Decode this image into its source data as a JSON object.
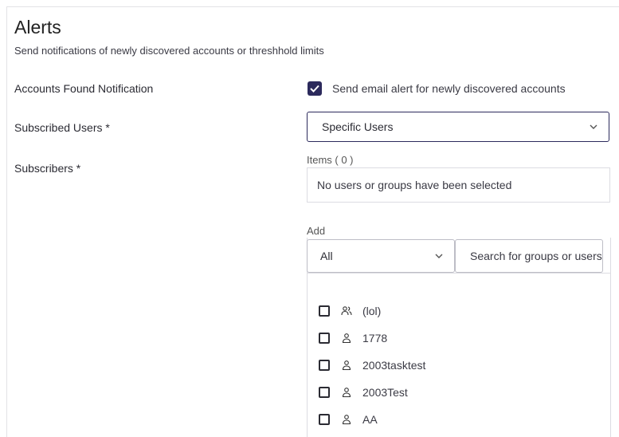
{
  "alerts": {
    "title": "Alerts",
    "subtitle": "Send notifications of newly discovered accounts or threshhold limits"
  },
  "accounts_found": {
    "label": "Accounts Found Notification",
    "checkbox_label": "Send email alert for newly discovered accounts",
    "checked": true
  },
  "subscribed_users": {
    "label": "Subscribed Users *",
    "value": "Specific Users"
  },
  "subscribers": {
    "label": "Subscribers *",
    "items_label": "Items ( 0 )",
    "empty_text": "No users or groups have been selected"
  },
  "add": {
    "label": "Add",
    "filter_value": "All",
    "search_placeholder": "Search for groups or users",
    "list": [
      {
        "name": "(lol)",
        "type": "group",
        "icon": "group-icon"
      },
      {
        "name": "1778",
        "type": "user",
        "icon": "user-icon"
      },
      {
        "name": "2003tasktest",
        "type": "user",
        "icon": "user-icon"
      },
      {
        "name": "2003Test",
        "type": "user",
        "icon": "user-icon"
      },
      {
        "name": "AA",
        "type": "user",
        "icon": "user-icon"
      }
    ]
  },
  "colors": {
    "accent": "#2c2a5c",
    "border": "#dcdce2"
  }
}
